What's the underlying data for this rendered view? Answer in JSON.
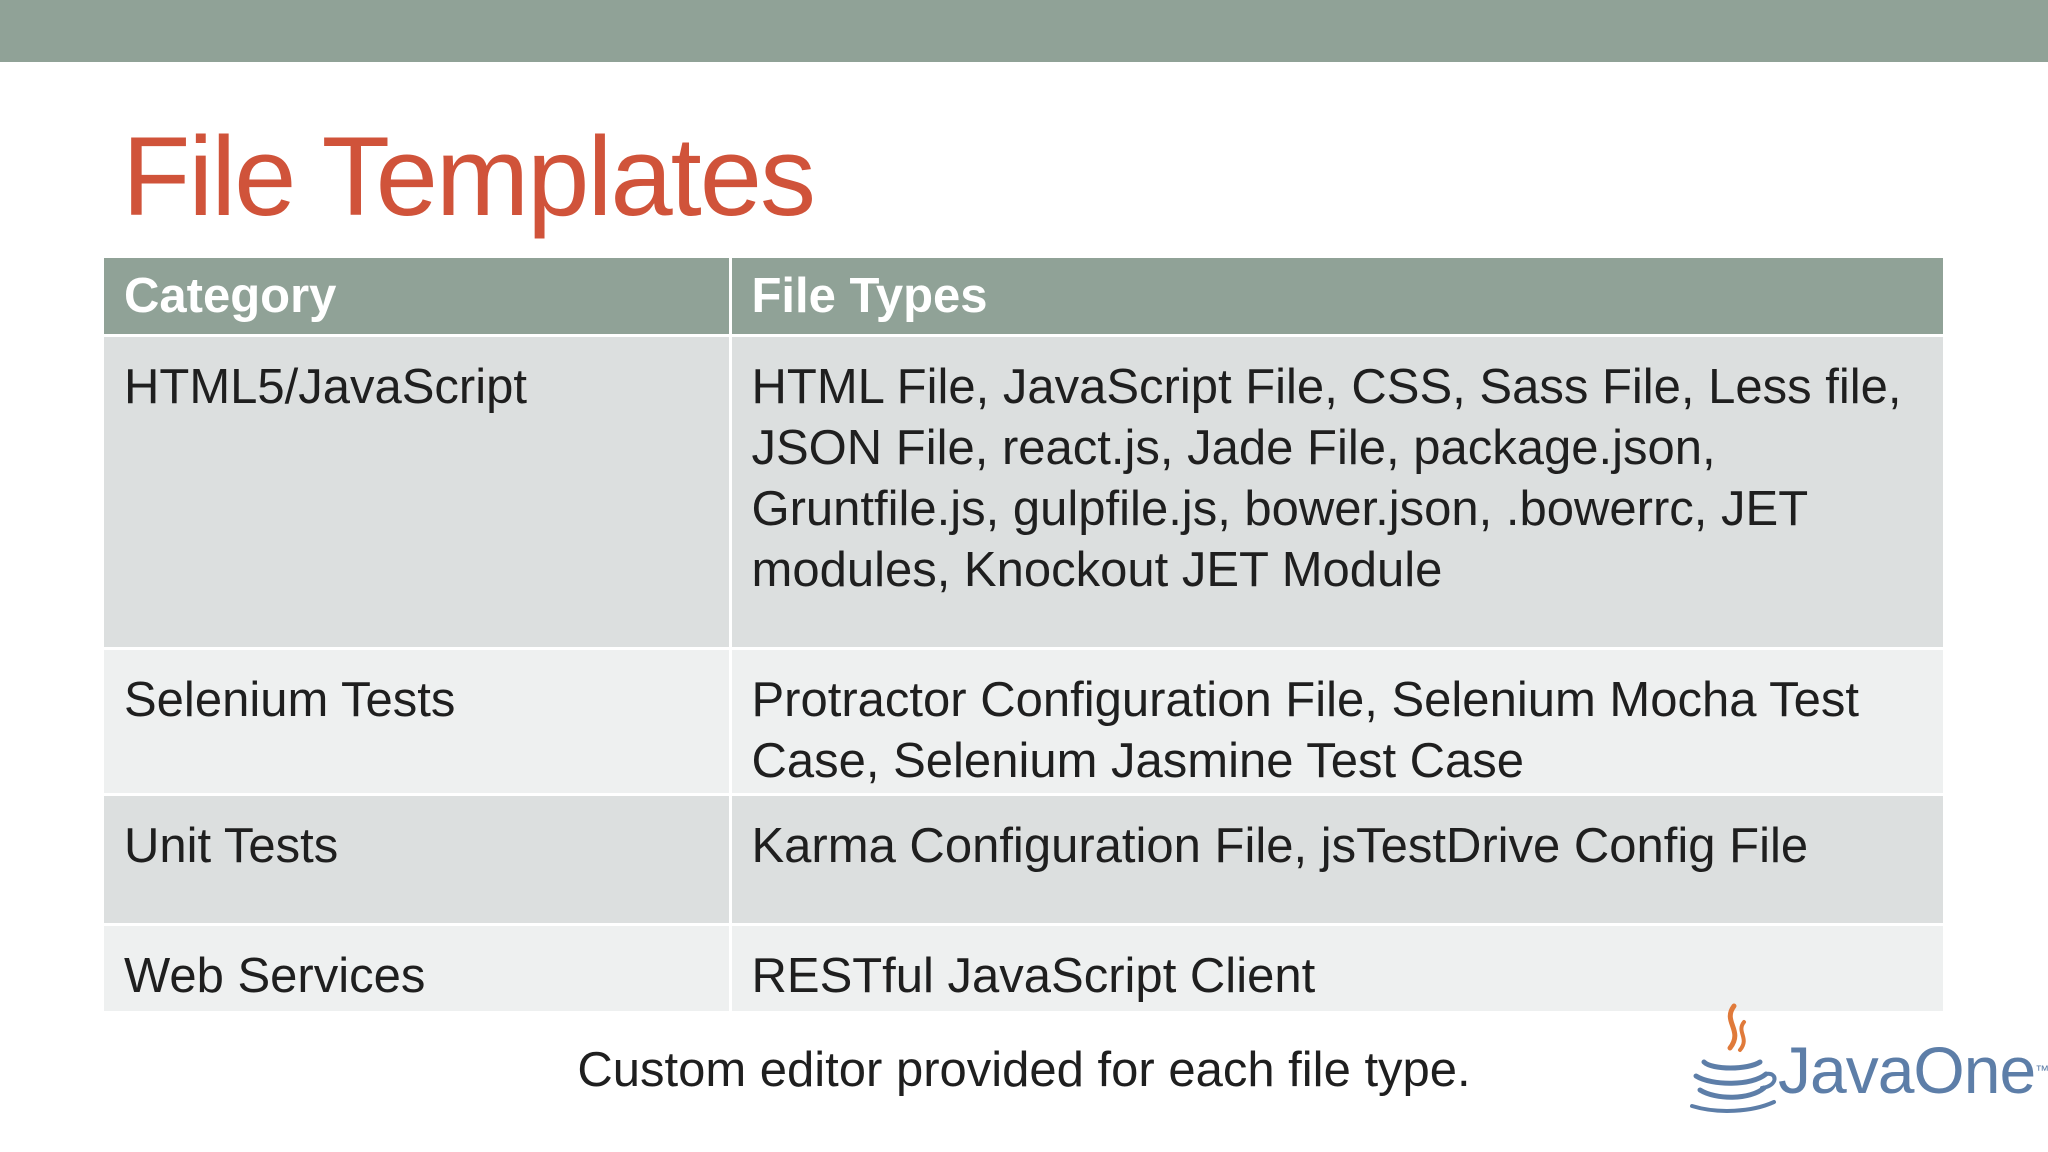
{
  "title": "File Templates",
  "table": {
    "headers": [
      "Category",
      "File Types"
    ],
    "rows": [
      {
        "category": "HTML5/JavaScript",
        "file_types": "HTML File, JavaScript File, CSS, Sass File, Less file, JSON File, react.js, Jade File, package.json, Gruntfile.js, gulpfile.js, bower.json, .bowerrc, JET modules, Knockout JET Module"
      },
      {
        "category": "Selenium Tests",
        "file_types": "Protractor Configuration File, Selenium Mocha Test Case, Selenium Jasmine Test Case"
      },
      {
        "category": "Unit Tests",
        "file_types": "Karma Configuration File, jsTestDrive Config File"
      },
      {
        "category": "Web Services",
        "file_types": "RESTful JavaScript Client"
      }
    ]
  },
  "footer_note": "Custom editor provided for each file type.",
  "logo": {
    "text": "JavaOne",
    "tm": "™",
    "icon": "java-cup-icon"
  },
  "colors": {
    "bar": "#90a297",
    "title": "#d0533a",
    "row_dark": "#dcdfdf",
    "row_light": "#eef0f0",
    "logo": "#5d7ea8"
  }
}
